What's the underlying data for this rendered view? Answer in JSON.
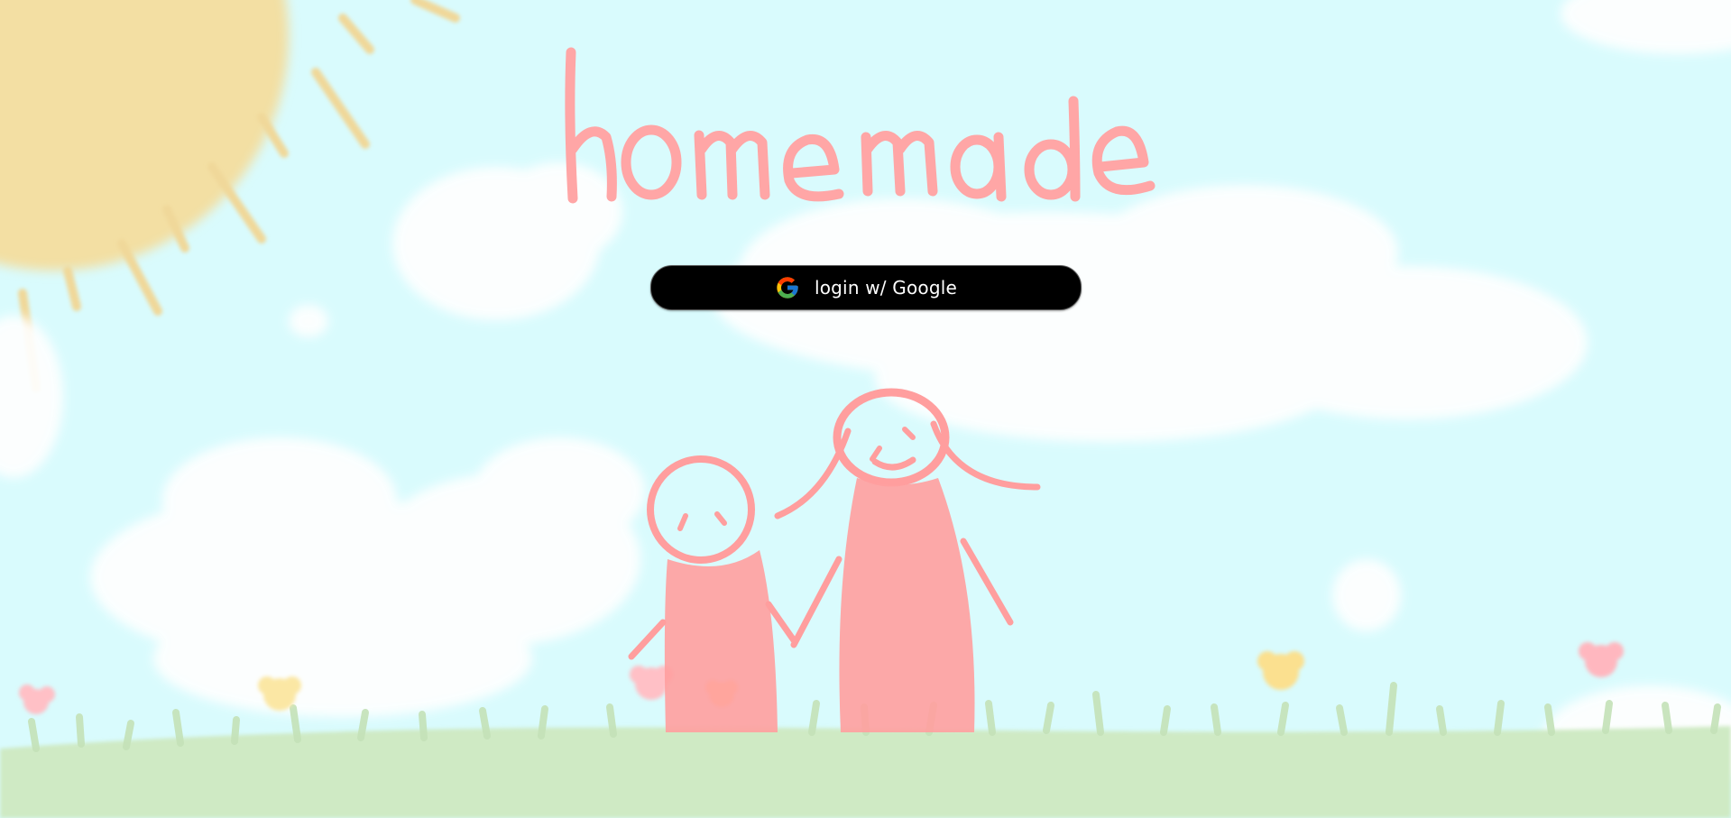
{
  "app": {
    "title": "homemade"
  },
  "login": {
    "label": "login w/ Google",
    "icon": "google-icon"
  },
  "colors": {
    "sky": "#d9fbfd",
    "cloud": "#ffffff",
    "sun": "#f3dfa3",
    "title": "#ffa6a6",
    "figures": "#ff9e9e",
    "grass": "#cfeac4",
    "button": "#000000",
    "button_text": "#ffffff"
  }
}
